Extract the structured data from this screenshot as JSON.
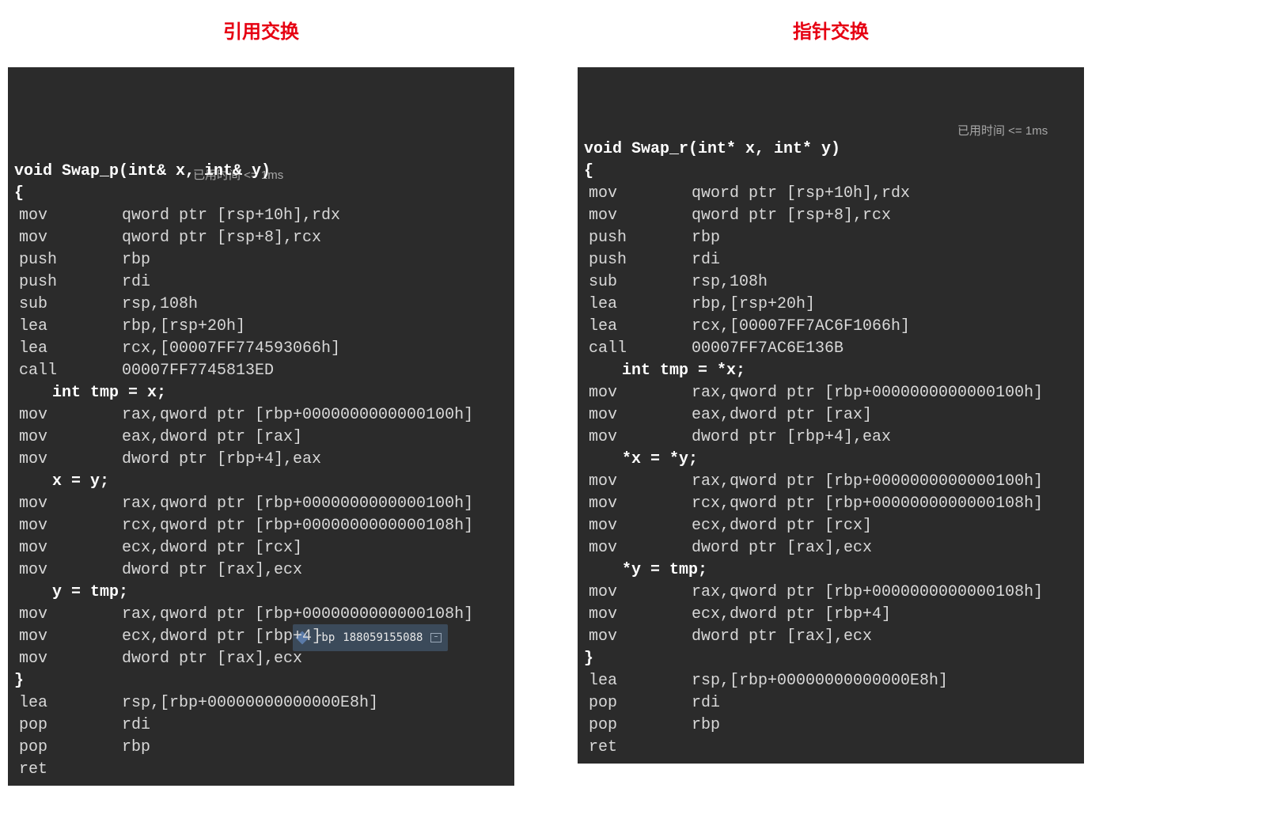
{
  "left": {
    "title": "引用交换",
    "hint": "已用时间 <= 1ms",
    "tooltip": {
      "reg": "rbp",
      "value": "188059155088"
    },
    "lines": [
      {
        "kind": "src",
        "text": "void Swap_p(int& x, int& y)"
      },
      {
        "kind": "brace",
        "text": "{"
      },
      {
        "kind": "asm",
        "op": "mov",
        "args": "qword ptr [rsp+10h],rdx"
      },
      {
        "kind": "asm",
        "op": "mov",
        "args": "qword ptr [rsp+8],rcx"
      },
      {
        "kind": "asm",
        "op": "push",
        "args": "rbp"
      },
      {
        "kind": "asm",
        "op": "push",
        "args": "rdi"
      },
      {
        "kind": "asm",
        "op": "sub",
        "args": "rsp,108h"
      },
      {
        "kind": "asm",
        "op": "lea",
        "args": "rbp,[rsp+20h]"
      },
      {
        "kind": "asm",
        "op": "lea",
        "args": "rcx,[00007FF774593066h]"
      },
      {
        "kind": "asm",
        "op": "call",
        "args": "00007FF7745813ED"
      },
      {
        "kind": "src",
        "text": "    int tmp = x;"
      },
      {
        "kind": "asm",
        "op": "mov",
        "args": "rax,qword ptr [rbp+0000000000000100h]"
      },
      {
        "kind": "asm",
        "op": "mov",
        "args": "eax,dword ptr [rax]"
      },
      {
        "kind": "asm",
        "op": "mov",
        "args": "dword ptr [rbp+4],eax"
      },
      {
        "kind": "src",
        "text": "    x = y;"
      },
      {
        "kind": "asm",
        "op": "mov",
        "args": "rax,qword ptr [rbp+0000000000000100h]"
      },
      {
        "kind": "asm",
        "op": "mov",
        "args": "rcx,qword ptr [rbp+0000000000000108h]"
      },
      {
        "kind": "asm",
        "op": "mov",
        "args": "ecx,dword ptr [rcx]"
      },
      {
        "kind": "asm",
        "op": "mov",
        "args": "dword ptr [rax],ecx"
      },
      {
        "kind": "src",
        "text": "    y = tmp;"
      },
      {
        "kind": "asm",
        "op": "mov",
        "args": "rax,qword ptr [rbp+0000000000000108h]"
      },
      {
        "kind": "asm",
        "op": "mov",
        "args": "ecx,dword ptr [rbp+4]"
      },
      {
        "kind": "asm",
        "op": "mov",
        "args": "dword ptr [rax],ecx"
      },
      {
        "kind": "brace",
        "text": "}"
      },
      {
        "kind": "asm",
        "op": "lea",
        "args": "rsp,[rbp+00000000000000E8h]"
      },
      {
        "kind": "asm",
        "op": "pop",
        "args": "rdi"
      },
      {
        "kind": "asm",
        "op": "pop",
        "args": "rbp"
      },
      {
        "kind": "asm",
        "op": "ret",
        "args": ""
      }
    ]
  },
  "right": {
    "title": "指针交换",
    "hint": "已用时间 <= 1ms",
    "lines": [
      {
        "kind": "src",
        "text": "void Swap_r(int* x, int* y)"
      },
      {
        "kind": "brace",
        "text": "{"
      },
      {
        "kind": "asm",
        "op": "mov",
        "args": "qword ptr [rsp+10h],rdx"
      },
      {
        "kind": "asm",
        "op": "mov",
        "args": "qword ptr [rsp+8],rcx"
      },
      {
        "kind": "asm",
        "op": "push",
        "args": "rbp"
      },
      {
        "kind": "asm",
        "op": "push",
        "args": "rdi"
      },
      {
        "kind": "asm",
        "op": "sub",
        "args": "rsp,108h"
      },
      {
        "kind": "asm",
        "op": "lea",
        "args": "rbp,[rsp+20h]"
      },
      {
        "kind": "asm",
        "op": "lea",
        "args": "rcx,[00007FF7AC6F1066h]"
      },
      {
        "kind": "asm",
        "op": "call",
        "args": "00007FF7AC6E136B"
      },
      {
        "kind": "src",
        "text": "    int tmp = *x;"
      },
      {
        "kind": "asm",
        "op": "mov",
        "args": "rax,qword ptr [rbp+0000000000000100h]"
      },
      {
        "kind": "asm",
        "op": "mov",
        "args": "eax,dword ptr [rax]"
      },
      {
        "kind": "asm",
        "op": "mov",
        "args": "dword ptr [rbp+4],eax"
      },
      {
        "kind": "src",
        "text": "    *x = *y;"
      },
      {
        "kind": "asm",
        "op": "mov",
        "args": "rax,qword ptr [rbp+0000000000000100h]"
      },
      {
        "kind": "asm",
        "op": "mov",
        "args": "rcx,qword ptr [rbp+0000000000000108h]"
      },
      {
        "kind": "asm",
        "op": "mov",
        "args": "ecx,dword ptr [rcx]"
      },
      {
        "kind": "asm",
        "op": "mov",
        "args": "dword ptr [rax],ecx"
      },
      {
        "kind": "src",
        "text": "    *y = tmp;"
      },
      {
        "kind": "asm",
        "op": "mov",
        "args": "rax,qword ptr [rbp+0000000000000108h]"
      },
      {
        "kind": "asm",
        "op": "mov",
        "args": "ecx,dword ptr [rbp+4]"
      },
      {
        "kind": "asm",
        "op": "mov",
        "args": "dword ptr [rax],ecx"
      },
      {
        "kind": "brace",
        "text": "}"
      },
      {
        "kind": "asm",
        "op": "lea",
        "args": "rsp,[rbp+00000000000000E8h]"
      },
      {
        "kind": "asm",
        "op": "pop",
        "args": "rdi"
      },
      {
        "kind": "asm",
        "op": "pop",
        "args": "rbp"
      },
      {
        "kind": "asm",
        "op": "ret",
        "args": ""
      }
    ]
  }
}
